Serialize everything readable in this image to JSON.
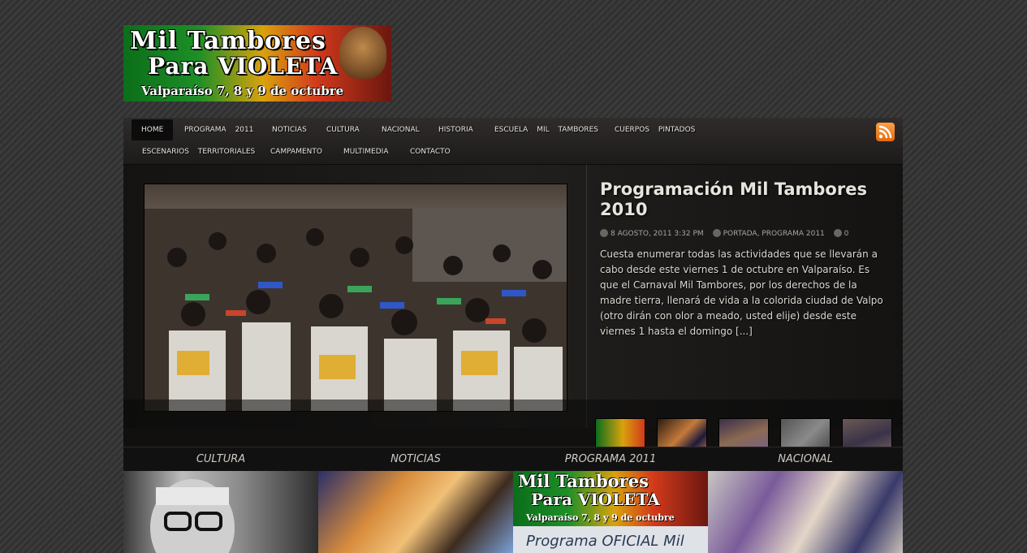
{
  "logo": {
    "line1": "Mil Tambores",
    "line2": "Para VIOLETA",
    "line3": "Valparaíso 7, 8 y 9 de octubre"
  },
  "nav": {
    "row1": [
      "HOME",
      "PROGRAMA 2011",
      "NOTICIAS",
      "CULTURA",
      "NACIONAL",
      "HISTORIA",
      "ESCUELA MIL TAMBORES",
      "CUERPOS PINTADOS"
    ],
    "row2": [
      "ESCENARIOS TERRITORIALES",
      "CAMPAMENTO",
      "MULTIMEDIA",
      "CONTACTO"
    ],
    "rss_icon": "rss-icon"
  },
  "featured": {
    "title": "Programación Mil Tambores 2010",
    "date": "8 AGOSTO, 2011 3:32 PM",
    "categories": "PORTADA, PROGRAMA 2011",
    "comments": "0",
    "excerpt": "Cuesta enumerar todas las actividades que se llevarán a cabo desde este viernes 1 de octubre en Valparaíso. Es que el Carnaval Mil Tambores, por los derechos de la madre tierra,  llenará de vida a la colorida ciudad de Valpo (otro dirán con olor a meado, usted elije) desde este viernes 1 hasta el domingo [...]"
  },
  "categories": [
    "CULTURA",
    "NOTICIAS",
    "PROGRAMA 2011",
    "NACIONAL"
  ],
  "cards": {
    "card3_title": "Programa OFICIAL Mil"
  },
  "colors": {
    "background": "#353535",
    "panel": "#1b1918",
    "rss": "#f08a24"
  }
}
